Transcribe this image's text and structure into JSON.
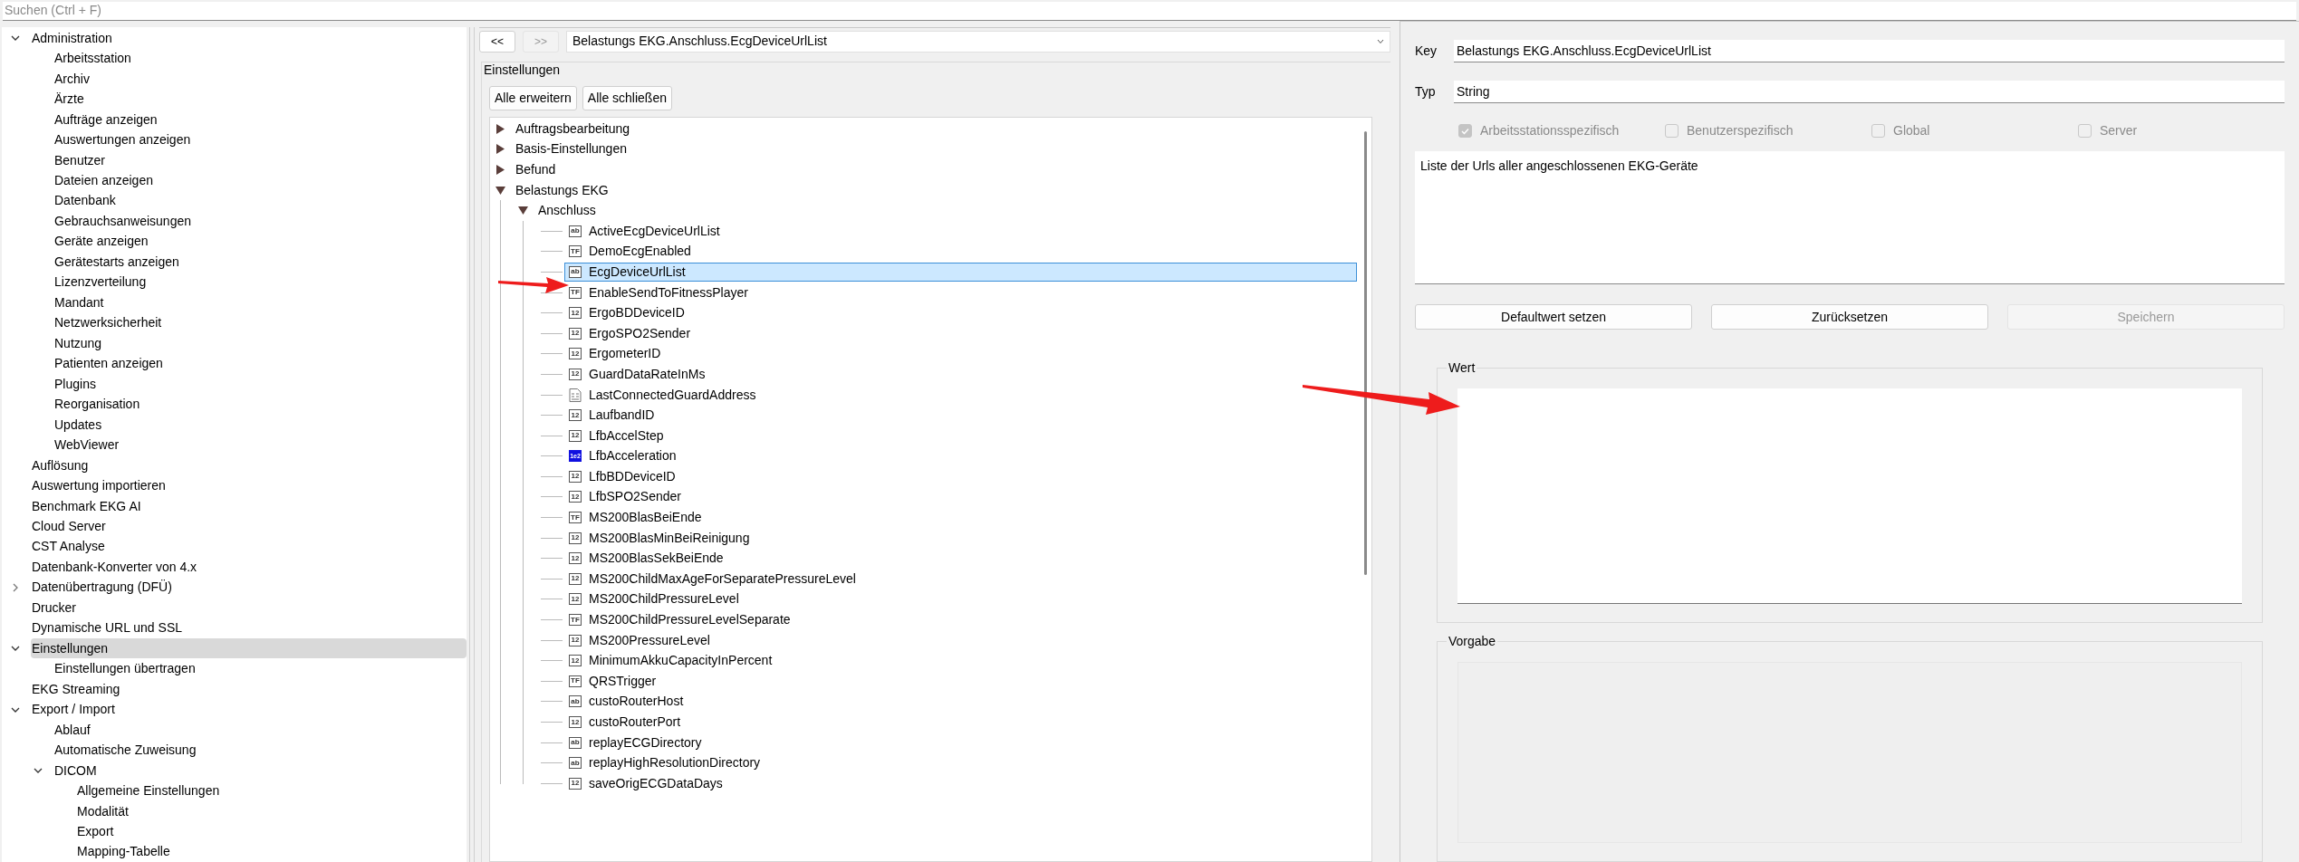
{
  "search": {
    "placeholder": "Suchen (Ctrl + F)"
  },
  "sidebar": {
    "items": [
      {
        "label": "Administration",
        "expanded": true,
        "selected": false,
        "children": [
          {
            "label": "Arbeitsstation",
            "selected": false
          },
          {
            "label": "Archiv",
            "selected": false
          },
          {
            "label": "Ärzte",
            "selected": false
          },
          {
            "label": "Aufträge anzeigen",
            "selected": false
          },
          {
            "label": "Auswertungen anzeigen",
            "selected": false
          },
          {
            "label": "Benutzer",
            "selected": false
          },
          {
            "label": "Dateien anzeigen",
            "selected": false
          },
          {
            "label": "Datenbank",
            "selected": false
          },
          {
            "label": "Gebrauchsanweisungen",
            "selected": false
          },
          {
            "label": "Geräte anzeigen",
            "selected": false
          },
          {
            "label": "Gerätestarts anzeigen",
            "selected": false
          },
          {
            "label": "Lizenzverteilung",
            "selected": false
          },
          {
            "label": "Mandant",
            "selected": false
          },
          {
            "label": "Netzwerksicherheit",
            "selected": false
          },
          {
            "label": "Nutzung",
            "selected": false
          },
          {
            "label": "Patienten anzeigen",
            "selected": false
          },
          {
            "label": "Plugins",
            "selected": false
          },
          {
            "label": "Reorganisation",
            "selected": false
          },
          {
            "label": "Updates",
            "selected": false
          },
          {
            "label": "WebViewer",
            "selected": false
          }
        ]
      },
      {
        "label": "Auflösung",
        "selected": false
      },
      {
        "label": "Auswertung importieren",
        "selected": false
      },
      {
        "label": "Benchmark EKG AI",
        "selected": false
      },
      {
        "label": "Cloud Server",
        "selected": false
      },
      {
        "label": "CST Analyse",
        "selected": false
      },
      {
        "label": "Datenbank-Konverter von 4.x",
        "selected": false
      },
      {
        "label": "Datenübertragung (DFÜ)",
        "expanded": false,
        "selected": false
      },
      {
        "label": "Drucker",
        "selected": false
      },
      {
        "label": "Dynamische URL und SSL",
        "selected": false
      },
      {
        "label": "Einstellungen",
        "expanded": true,
        "selected": true,
        "children": [
          {
            "label": "Einstellungen übertragen",
            "selected": false
          }
        ]
      },
      {
        "label": "EKG Streaming",
        "selected": false
      },
      {
        "label": "Export / Import",
        "expanded": true,
        "selected": false,
        "children": [
          {
            "label": "Ablauf",
            "selected": false
          },
          {
            "label": "Automatische Zuweisung",
            "selected": false
          },
          {
            "label": "DICOM",
            "expanded": true,
            "selected": false,
            "children": [
              {
                "label": "Allgemeine Einstellungen",
                "selected": false
              },
              {
                "label": "Modalität",
                "selected": false
              },
              {
                "label": "Export",
                "selected": false
              },
              {
                "label": "Mapping-Tabelle",
                "selected": false
              }
            ]
          }
        ]
      }
    ]
  },
  "nav": {
    "back": {
      "label": "<<",
      "disabled": false
    },
    "forward": {
      "label": ">>",
      "disabled": true
    },
    "path": "Belastungs EKG.Anschluss.EcgDeviceUrlList"
  },
  "settings": {
    "title": "Einstellungen",
    "buttons": [
      "Alle erweitern",
      "Alle schließen"
    ],
    "tree": [
      {
        "label": "Auftragsbearbeitung",
        "expanded": false,
        "selected": false
      },
      {
        "label": "Basis-Einstellungen",
        "expanded": false,
        "selected": false
      },
      {
        "label": "Befund",
        "expanded": false,
        "selected": false
      },
      {
        "label": "Belastungs EKG",
        "expanded": true,
        "selected": false,
        "children": [
          {
            "label": "Anschluss",
            "expanded": true,
            "selected": false,
            "children": [
              {
                "label": "ActiveEcgDeviceUrlList",
                "kind": "string",
                "badge": "ab",
                "selected": false
              },
              {
                "label": "DemoEcgEnabled",
                "kind": "bool",
                "badge": "TF",
                "selected": false
              },
              {
                "label": "EcgDeviceUrlList",
                "kind": "string",
                "badge": "ab",
                "selected": true
              },
              {
                "label": "EnableSendToFitnessPlayer",
                "kind": "bool",
                "badge": "TF",
                "selected": false
              },
              {
                "label": "ErgoBDDeviceID",
                "kind": "int",
                "badge": "12",
                "selected": false
              },
              {
                "label": "ErgoSPO2Sender",
                "kind": "int",
                "badge": "12",
                "selected": false
              },
              {
                "label": "ErgometerID",
                "kind": "int",
                "badge": "12",
                "selected": false
              },
              {
                "label": "GuardDataRateInMs",
                "kind": "int",
                "badge": "12",
                "selected": false
              },
              {
                "label": "LastConnectedGuardAddress",
                "kind": "binary",
                "selected": false
              },
              {
                "label": "LaufbandID",
                "kind": "int",
                "badge": "12",
                "selected": false
              },
              {
                "label": "LfbAccelStep",
                "kind": "int",
                "badge": "12",
                "selected": false
              },
              {
                "label": "LfbAcceleration",
                "kind": "double",
                "badge": "1e2",
                "selected": false
              },
              {
                "label": "LfbBDDeviceID",
                "kind": "int",
                "badge": "12",
                "selected": false
              },
              {
                "label": "LfbSPO2Sender",
                "kind": "int",
                "badge": "12",
                "selected": false
              },
              {
                "label": "MS200BlasBeiEnde",
                "kind": "bool",
                "badge": "TF",
                "selected": false
              },
              {
                "label": "MS200BlasMinBeiReinigung",
                "kind": "int",
                "badge": "12",
                "selected": false
              },
              {
                "label": "MS200BlasSekBeiEnde",
                "kind": "int",
                "badge": "12",
                "selected": false
              },
              {
                "label": "MS200ChildMaxAgeForSeparatePressureLevel",
                "kind": "int",
                "badge": "12",
                "selected": false
              },
              {
                "label": "MS200ChildPressureLevel",
                "kind": "int",
                "badge": "12",
                "selected": false
              },
              {
                "label": "MS200ChildPressureLevelSeparate",
                "kind": "bool",
                "badge": "TF",
                "selected": false
              },
              {
                "label": "MS200PressureLevel",
                "kind": "int",
                "badge": "12",
                "selected": false
              },
              {
                "label": "MinimumAkkuCapacityInPercent",
                "kind": "int",
                "badge": "12",
                "selected": false
              },
              {
                "label": "QRSTrigger",
                "kind": "bool",
                "badge": "TF",
                "selected": false
              },
              {
                "label": "custoRouterHost",
                "kind": "string",
                "badge": "ab",
                "selected": false
              },
              {
                "label": "custoRouterPort",
                "kind": "int",
                "badge": "12",
                "selected": false
              },
              {
                "label": "replayECGDirectory",
                "kind": "string",
                "badge": "ab",
                "selected": false
              },
              {
                "label": "replayHighResolutionDirectory",
                "kind": "string",
                "badge": "ab",
                "selected": false
              },
              {
                "label": "saveOrigECGDataDays",
                "kind": "int",
                "badge": "12",
                "selected": false
              }
            ]
          }
        ]
      }
    ]
  },
  "detail": {
    "fields": [
      {
        "label": "Key",
        "value": "Belastungs EKG.Anschluss.EcgDeviceUrlList"
      },
      {
        "label": "Typ",
        "value": "String"
      }
    ],
    "scopes": [
      {
        "label": "Arbeitsstationsspezifisch",
        "checked": true,
        "disabled": true
      },
      {
        "label": "Benutzerspezifisch",
        "checked": false,
        "disabled": true
      },
      {
        "label": "Global",
        "checked": false,
        "disabled": true
      },
      {
        "label": "Server",
        "checked": false,
        "disabled": true
      }
    ],
    "description": "Liste der Urls aller angeschlossenen EKG-Geräte",
    "buttons": [
      {
        "label": "Defaultwert setzen",
        "disabled": false
      },
      {
        "label": "Zurücksetzen",
        "disabled": false
      },
      {
        "label": "Speichern",
        "disabled": true
      }
    ],
    "value_group": {
      "title": "Wert",
      "disabled": false
    },
    "default_group": {
      "title": "Vorgabe",
      "disabled": true
    }
  }
}
